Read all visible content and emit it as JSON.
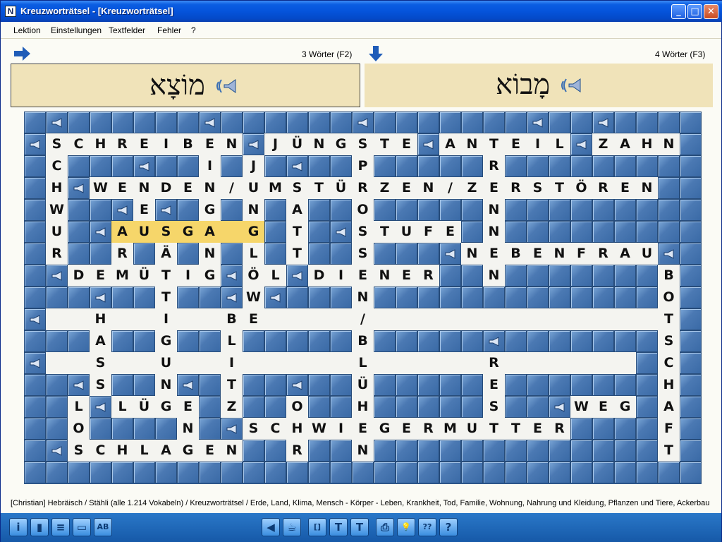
{
  "window": {
    "title": "Kreuzworträtsel - [Kreuzworträtsel]"
  },
  "menu": [
    "Lektion",
    "Einstellungen",
    "Textfelder",
    "Fehler",
    "?"
  ],
  "across": {
    "count_label": "3 Wörter (F2)",
    "hebrew": "מוֹצָא"
  },
  "down": {
    "count_label": "4 Wörter (F3)",
    "hebrew": "מָבוֹא"
  },
  "status": "[Christian]  Hebräisch / Stähli  (alle 1.214 Vokabeln) / Kreuzworträtsel / Erde, Land, Klima, Mensch - Körper - Leben, Krankheit, Tod, Familie, Wohnung, Nahrung und Kleidung, Pflanzen und Tiere, Ackerbau",
  "colors": {
    "board": "#2f5b92",
    "panel": "#f0e3b9",
    "selected": "#f6d66a"
  },
  "icons": {
    "toolbar": [
      "info-icon",
      "book-icon",
      "list-icon",
      "card-icon",
      "ab-icon",
      "back-icon",
      "teacup-icon",
      "brackets-icon",
      "text-t-icon",
      "text-t2-icon",
      "print-icon",
      "lightbulb-icon",
      "help-question-icon",
      "help-icon"
    ],
    "toolbar_glyphs": [
      "i",
      "▮",
      "≡",
      "▭",
      "AB",
      "◀",
      "☕",
      "[]",
      "T",
      "T",
      "⎙",
      "💡",
      "??",
      "?"
    ]
  },
  "grid": {
    "rows": [
      "###############################",
      "#SCHREIBEN#JÜNGSTE#ANTEIL#ZAHN#",
      "#C####I#J###P##.##R##.##.######",
      "#H#WENDEN/UMSTÜRZEN/ZERSTÖREN.#",
      "#W##E##G#N#A##O##.##N##.##..###",
      "#U#AUSGA.G#T##STUFE#N##.##..###",
      "#R##R#Ä#N#L#T##S##.#NEBENFRAU###",
      "##DEMÜTIG#ÖL#DIENER##N##.##..#B#",
      "#####T###W##N#########...##..#O#",
      "#...H..I..BE....../..........T#",
      "####A##G##L####B##.####.##..S#",
      "#...S..U..I.....L..R.......C#",
      "####S##N##T####Ü###E##.##..H#",
      "#.L#LÜGE##Z####H###S##WEG.A#",
      "#.O####N#SCHWIEGERMUTTER##F#",
      "##SCHLAGEN##R###N##########T#",
      "###############################"
    ]
  },
  "cells": [
    {
      "r": 1,
      "c": 1,
      "t": "S"
    },
    {
      "r": 1,
      "c": 2,
      "t": "C"
    },
    {
      "r": 1,
      "c": 3,
      "t": "H"
    },
    {
      "r": 1,
      "c": 4,
      "t": "R"
    },
    {
      "r": 1,
      "c": 5,
      "t": "E"
    },
    {
      "r": 1,
      "c": 6,
      "t": "I"
    },
    {
      "r": 1,
      "c": 7,
      "t": "B"
    },
    {
      "r": 1,
      "c": 8,
      "t": "E"
    },
    {
      "r": 1,
      "c": 9,
      "t": "N"
    },
    {
      "r": 1,
      "c": 11,
      "t": "J"
    },
    {
      "r": 1,
      "c": 12,
      "t": "Ü"
    },
    {
      "r": 1,
      "c": 13,
      "t": "N"
    },
    {
      "r": 1,
      "c": 14,
      "t": "G"
    },
    {
      "r": 1,
      "c": 15,
      "t": "S"
    },
    {
      "r": 1,
      "c": 16,
      "t": "T"
    },
    {
      "r": 1,
      "c": 17,
      "t": "E"
    },
    {
      "r": 1,
      "c": 19,
      "t": "A"
    },
    {
      "r": 1,
      "c": 20,
      "t": "N"
    },
    {
      "r": 1,
      "c": 21,
      "t": "T"
    },
    {
      "r": 1,
      "c": 22,
      "t": "E"
    },
    {
      "r": 1,
      "c": 23,
      "t": "I"
    },
    {
      "r": 1,
      "c": 24,
      "t": "L"
    },
    {
      "r": 1,
      "c": 26,
      "t": "Z"
    },
    {
      "r": 1,
      "c": 27,
      "t": "A"
    },
    {
      "r": 1,
      "c": 28,
      "t": "H"
    },
    {
      "r": 1,
      "c": 29,
      "t": "N"
    },
    {
      "r": 2,
      "c": 1,
      "t": "C"
    },
    {
      "r": 2,
      "c": 8,
      "t": "I"
    },
    {
      "r": 2,
      "c": 10,
      "t": "J"
    },
    {
      "r": 2,
      "c": 15,
      "t": "P"
    },
    {
      "r": 2,
      "c": 21,
      "t": "R"
    },
    {
      "r": 3,
      "c": 1,
      "t": "H"
    },
    {
      "r": 3,
      "c": 3,
      "t": "W"
    },
    {
      "r": 3,
      "c": 4,
      "t": "E"
    },
    {
      "r": 3,
      "c": 5,
      "t": "N"
    },
    {
      "r": 3,
      "c": 6,
      "t": "D"
    },
    {
      "r": 3,
      "c": 7,
      "t": "E"
    },
    {
      "r": 3,
      "c": 8,
      "t": "N"
    },
    {
      "r": 3,
      "c": 9,
      "t": "/"
    },
    {
      "r": 3,
      "c": 10,
      "t": "U"
    },
    {
      "r": 3,
      "c": 11,
      "t": "M"
    },
    {
      "r": 3,
      "c": 12,
      "t": "S"
    },
    {
      "r": 3,
      "c": 13,
      "t": "T"
    },
    {
      "r": 3,
      "c": 14,
      "t": "Ü"
    },
    {
      "r": 3,
      "c": 15,
      "t": "R"
    },
    {
      "r": 3,
      "c": 16,
      "t": "Z"
    },
    {
      "r": 3,
      "c": 17,
      "t": "E"
    },
    {
      "r": 3,
      "c": 18,
      "t": "N"
    },
    {
      "r": 3,
      "c": 19,
      "t": "/"
    },
    {
      "r": 3,
      "c": 20,
      "t": "Z"
    },
    {
      "r": 3,
      "c": 21,
      "t": "E"
    },
    {
      "r": 3,
      "c": 22,
      "t": "R"
    },
    {
      "r": 3,
      "c": 23,
      "t": "S"
    },
    {
      "r": 3,
      "c": 24,
      "t": "T"
    },
    {
      "r": 3,
      "c": 25,
      "t": "Ö"
    },
    {
      "r": 3,
      "c": 26,
      "t": "R"
    },
    {
      "r": 3,
      "c": 27,
      "t": "E"
    },
    {
      "r": 3,
      "c": 28,
      "t": "N"
    },
    {
      "r": 4,
      "c": 1,
      "t": "W"
    },
    {
      "r": 4,
      "c": 5,
      "t": "E"
    },
    {
      "r": 4,
      "c": 8,
      "t": "G"
    },
    {
      "r": 4,
      "c": 10,
      "t": "N"
    },
    {
      "r": 4,
      "c": 12,
      "t": "A"
    },
    {
      "r": 4,
      "c": 15,
      "t": "O"
    },
    {
      "r": 4,
      "c": 21,
      "t": "N"
    },
    {
      "r": 5,
      "c": 1,
      "t": "U"
    },
    {
      "r": 5,
      "c": 4,
      "t": "A",
      "s": 1
    },
    {
      "r": 5,
      "c": 5,
      "t": "U",
      "s": 1
    },
    {
      "r": 5,
      "c": 6,
      "t": "S",
      "s": 1
    },
    {
      "r": 5,
      "c": 7,
      "t": "G",
      "s": 1
    },
    {
      "r": 5,
      "c": 8,
      "t": "A",
      "s": 1
    },
    {
      "r": 5,
      "c": 9,
      "t": "",
      "s": 1
    },
    {
      "r": 5,
      "c": 10,
      "t": "G",
      "s": 1
    },
    {
      "r": 5,
      "c": 12,
      "t": "T"
    },
    {
      "r": 5,
      "c": 15,
      "t": "S"
    },
    {
      "r": 5,
      "c": 16,
      "t": "T"
    },
    {
      "r": 5,
      "c": 17,
      "t": "U"
    },
    {
      "r": 5,
      "c": 18,
      "t": "F"
    },
    {
      "r": 5,
      "c": 19,
      "t": "E"
    },
    {
      "r": 5,
      "c": 21,
      "t": "N"
    },
    {
      "r": 6,
      "c": 1,
      "t": "R"
    },
    {
      "r": 6,
      "c": 4,
      "t": "R"
    },
    {
      "r": 6,
      "c": 6,
      "t": "Ä"
    },
    {
      "r": 6,
      "c": 8,
      "t": "N"
    },
    {
      "r": 6,
      "c": 10,
      "t": "L"
    },
    {
      "r": 6,
      "c": 12,
      "t": "T"
    },
    {
      "r": 6,
      "c": 15,
      "t": "S"
    },
    {
      "r": 6,
      "c": 20,
      "t": "N"
    },
    {
      "r": 6,
      "c": 21,
      "t": "E"
    },
    {
      "r": 6,
      "c": 22,
      "t": "B"
    },
    {
      "r": 6,
      "c": 23,
      "t": "E"
    },
    {
      "r": 6,
      "c": 24,
      "t": "N"
    },
    {
      "r": 6,
      "c": 25,
      "t": "F"
    },
    {
      "r": 6,
      "c": 26,
      "t": "R"
    },
    {
      "r": 6,
      "c": 27,
      "t": "A"
    },
    {
      "r": 6,
      "c": 28,
      "t": "U"
    },
    {
      "r": 7,
      "c": 2,
      "t": "D"
    },
    {
      "r": 7,
      "c": 3,
      "t": "E"
    },
    {
      "r": 7,
      "c": 4,
      "t": "M"
    },
    {
      "r": 7,
      "c": 5,
      "t": "Ü"
    },
    {
      "r": 7,
      "c": 6,
      "t": "T"
    },
    {
      "r": 7,
      "c": 7,
      "t": "I"
    },
    {
      "r": 7,
      "c": 8,
      "t": "G"
    },
    {
      "r": 7,
      "c": 10,
      "t": "Ö"
    },
    {
      "r": 7,
      "c": 11,
      "t": "L"
    },
    {
      "r": 7,
      "c": 13,
      "t": "D"
    },
    {
      "r": 7,
      "c": 14,
      "t": "I"
    },
    {
      "r": 7,
      "c": 15,
      "t": "E"
    },
    {
      "r": 7,
      "c": 16,
      "t": "N"
    },
    {
      "r": 7,
      "c": 17,
      "t": "E"
    },
    {
      "r": 7,
      "c": 18,
      "t": "R"
    },
    {
      "r": 7,
      "c": 21,
      "t": "N"
    },
    {
      "r": 7,
      "c": 29,
      "t": "B"
    },
    {
      "r": 8,
      "c": 6,
      "t": "T"
    },
    {
      "r": 8,
      "c": 10,
      "t": "W"
    },
    {
      "r": 8,
      "c": 15,
      "t": "N"
    },
    {
      "r": 8,
      "c": 29,
      "t": "O"
    },
    {
      "r": 9,
      "c": 1,
      "t": ""
    },
    {
      "r": 9,
      "c": 2,
      "t": ""
    },
    {
      "r": 9,
      "c": 3,
      "t": "H"
    },
    {
      "r": 9,
      "c": 4,
      "t": ""
    },
    {
      "r": 9,
      "c": 5,
      "t": ""
    },
    {
      "r": 9,
      "c": 6,
      "t": "I"
    },
    {
      "r": 9,
      "c": 7,
      "t": ""
    },
    {
      "r": 9,
      "c": 8,
      "t": ""
    },
    {
      "r": 9,
      "c": 9,
      "t": "B"
    },
    {
      "r": 9,
      "c": 10,
      "t": "E"
    },
    {
      "r": 9,
      "c": 11,
      "t": ""
    },
    {
      "r": 9,
      "c": 12,
      "t": ""
    },
    {
      "r": 9,
      "c": 13,
      "t": ""
    },
    {
      "r": 9,
      "c": 14,
      "t": ""
    },
    {
      "r": 9,
      "c": 15,
      "t": "/"
    },
    {
      "r": 9,
      "c": 16,
      "t": ""
    },
    {
      "r": 9,
      "c": 17,
      "t": ""
    },
    {
      "r": 9,
      "c": 18,
      "t": ""
    },
    {
      "r": 9,
      "c": 19,
      "t": ""
    },
    {
      "r": 9,
      "c": 20,
      "t": ""
    },
    {
      "r": 9,
      "c": 21,
      "t": ""
    },
    {
      "r": 9,
      "c": 22,
      "t": ""
    },
    {
      "r": 9,
      "c": 23,
      "t": ""
    },
    {
      "r": 9,
      "c": 24,
      "t": ""
    },
    {
      "r": 9,
      "c": 25,
      "t": ""
    },
    {
      "r": 9,
      "c": 26,
      "t": ""
    },
    {
      "r": 9,
      "c": 27,
      "t": ""
    },
    {
      "r": 9,
      "c": 28,
      "t": ""
    },
    {
      "r": 9,
      "c": 29,
      "t": "T"
    },
    {
      "r": 10,
      "c": 3,
      "t": "A"
    },
    {
      "r": 10,
      "c": 6,
      "t": "G"
    },
    {
      "r": 10,
      "c": 9,
      "t": "L"
    },
    {
      "r": 10,
      "c": 15,
      "t": "B"
    },
    {
      "r": 10,
      "c": 29,
      "t": "S"
    },
    {
      "r": 11,
      "c": 1,
      "t": ""
    },
    {
      "r": 11,
      "c": 2,
      "t": ""
    },
    {
      "r": 11,
      "c": 3,
      "t": "S"
    },
    {
      "r": 11,
      "c": 4,
      "t": ""
    },
    {
      "r": 11,
      "c": 5,
      "t": ""
    },
    {
      "r": 11,
      "c": 6,
      "t": "U"
    },
    {
      "r": 11,
      "c": 7,
      "t": ""
    },
    {
      "r": 11,
      "c": 8,
      "t": ""
    },
    {
      "r": 11,
      "c": 9,
      "t": "I"
    },
    {
      "r": 11,
      "c": 10,
      "t": ""
    },
    {
      "r": 11,
      "c": 11,
      "t": ""
    },
    {
      "r": 11,
      "c": 12,
      "t": ""
    },
    {
      "r": 11,
      "c": 13,
      "t": ""
    },
    {
      "r": 11,
      "c": 14,
      "t": ""
    },
    {
      "r": 11,
      "c": 15,
      "t": "L"
    },
    {
      "r": 11,
      "c": 16,
      "t": ""
    },
    {
      "r": 11,
      "c": 17,
      "t": ""
    },
    {
      "r": 11,
      "c": 18,
      "t": ""
    },
    {
      "r": 11,
      "c": 19,
      "t": ""
    },
    {
      "r": 11,
      "c": 20,
      "t": ""
    },
    {
      "r": 11,
      "c": 21,
      "t": "R"
    },
    {
      "r": 11,
      "c": 22,
      "t": ""
    },
    {
      "r": 11,
      "c": 23,
      "t": ""
    },
    {
      "r": 11,
      "c": 24,
      "t": ""
    },
    {
      "r": 11,
      "c": 25,
      "t": ""
    },
    {
      "r": 11,
      "c": 26,
      "t": ""
    },
    {
      "r": 11,
      "c": 27,
      "t": ""
    },
    {
      "r": 11,
      "c": 29,
      "t": "C"
    },
    {
      "r": 12,
      "c": 3,
      "t": "S"
    },
    {
      "r": 12,
      "c": 6,
      "t": "N"
    },
    {
      "r": 12,
      "c": 9,
      "t": "T"
    },
    {
      "r": 12,
      "c": 15,
      "t": "Ü"
    },
    {
      "r": 12,
      "c": 21,
      "t": "E"
    },
    {
      "r": 12,
      "c": 29,
      "t": "H"
    },
    {
      "r": 13,
      "c": 2,
      "t": "L"
    },
    {
      "r": 13,
      "c": 4,
      "t": "L"
    },
    {
      "r": 13,
      "c": 5,
      "t": "Ü"
    },
    {
      "r": 13,
      "c": 6,
      "t": "G"
    },
    {
      "r": 13,
      "c": 7,
      "t": "E"
    },
    {
      "r": 13,
      "c": 9,
      "t": "Z"
    },
    {
      "r": 13,
      "c": 12,
      "t": "O"
    },
    {
      "r": 13,
      "c": 15,
      "t": "H"
    },
    {
      "r": 13,
      "c": 21,
      "t": "S"
    },
    {
      "r": 13,
      "c": 25,
      "t": "W"
    },
    {
      "r": 13,
      "c": 26,
      "t": "E"
    },
    {
      "r": 13,
      "c": 27,
      "t": "G"
    },
    {
      "r": 13,
      "c": 29,
      "t": "A"
    },
    {
      "r": 14,
      "c": 2,
      "t": "O"
    },
    {
      "r": 14,
      "c": 7,
      "t": "N"
    },
    {
      "r": 14,
      "c": 10,
      "t": "S"
    },
    {
      "r": 14,
      "c": 11,
      "t": "C"
    },
    {
      "r": 14,
      "c": 12,
      "t": "H"
    },
    {
      "r": 14,
      "c": 13,
      "t": "W"
    },
    {
      "r": 14,
      "c": 14,
      "t": "I"
    },
    {
      "r": 14,
      "c": 15,
      "t": "E"
    },
    {
      "r": 14,
      "c": 16,
      "t": "G"
    },
    {
      "r": 14,
      "c": 17,
      "t": "E"
    },
    {
      "r": 14,
      "c": 18,
      "t": "R"
    },
    {
      "r": 14,
      "c": 19,
      "t": "M"
    },
    {
      "r": 14,
      "c": 20,
      "t": "U"
    },
    {
      "r": 14,
      "c": 21,
      "t": "T"
    },
    {
      "r": 14,
      "c": 22,
      "t": "T"
    },
    {
      "r": 14,
      "c": 23,
      "t": "E"
    },
    {
      "r": 14,
      "c": 24,
      "t": "R"
    },
    {
      "r": 14,
      "c": 29,
      "t": "F"
    },
    {
      "r": 15,
      "c": 2,
      "t": "S"
    },
    {
      "r": 15,
      "c": 3,
      "t": "C"
    },
    {
      "r": 15,
      "c": 4,
      "t": "H"
    },
    {
      "r": 15,
      "c": 5,
      "t": "L"
    },
    {
      "r": 15,
      "c": 6,
      "t": "A"
    },
    {
      "r": 15,
      "c": 7,
      "t": "G"
    },
    {
      "r": 15,
      "c": 8,
      "t": "E"
    },
    {
      "r": 15,
      "c": 9,
      "t": "N"
    },
    {
      "r": 15,
      "c": 12,
      "t": "R"
    },
    {
      "r": 15,
      "c": 15,
      "t": "N"
    },
    {
      "r": 15,
      "c": 29,
      "t": "T"
    }
  ],
  "speakers": [
    [
      0,
      1
    ],
    [
      0,
      8
    ],
    [
      0,
      15
    ],
    [
      0,
      23
    ],
    [
      0,
      26
    ],
    [
      1,
      0
    ],
    [
      1,
      10
    ],
    [
      1,
      18
    ],
    [
      1,
      25
    ],
    [
      2,
      5
    ],
    [
      2,
      12
    ],
    [
      3,
      2
    ],
    [
      4,
      4
    ],
    [
      4,
      6
    ],
    [
      5,
      3
    ],
    [
      5,
      14
    ],
    [
      6,
      19
    ],
    [
      6,
      29
    ],
    [
      7,
      1
    ],
    [
      7,
      9
    ],
    [
      7,
      12
    ],
    [
      8,
      3
    ],
    [
      8,
      9
    ],
    [
      8,
      11
    ],
    [
      9,
      0
    ],
    [
      10,
      21
    ],
    [
      11,
      0
    ],
    [
      12,
      2
    ],
    [
      12,
      7
    ],
    [
      12,
      12
    ],
    [
      13,
      3
    ],
    [
      13,
      24
    ],
    [
      14,
      9
    ],
    [
      15,
      1
    ]
  ]
}
